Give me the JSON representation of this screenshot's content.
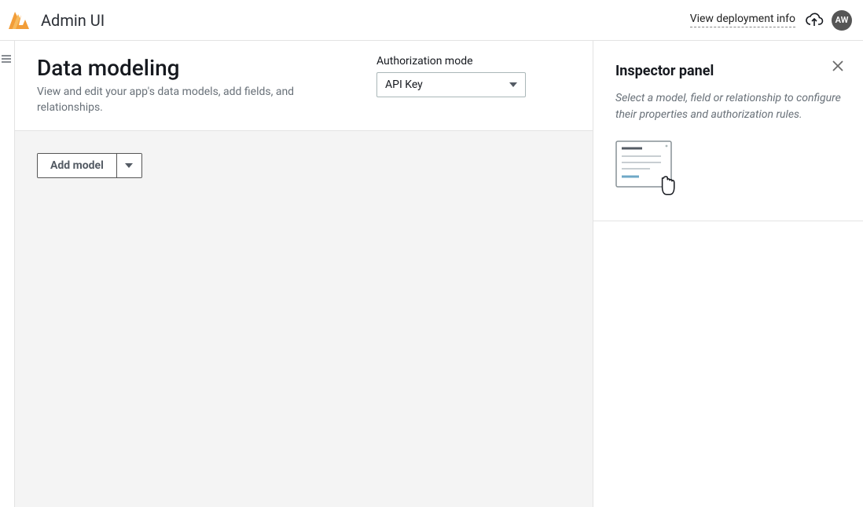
{
  "header": {
    "app_title": "Admin UI",
    "deploy_link": "View deployment info",
    "avatar_initials": "AW"
  },
  "main": {
    "title": "Data modeling",
    "subtitle": "View and edit your app's data models, add fields, and relationships.",
    "auth_mode": {
      "label": "Authorization mode",
      "selected": "API Key"
    },
    "add_model_label": "Add model"
  },
  "inspector": {
    "title": "Inspector panel",
    "help": "Select a model, field or relationship to configure their properties and authorization rules."
  }
}
